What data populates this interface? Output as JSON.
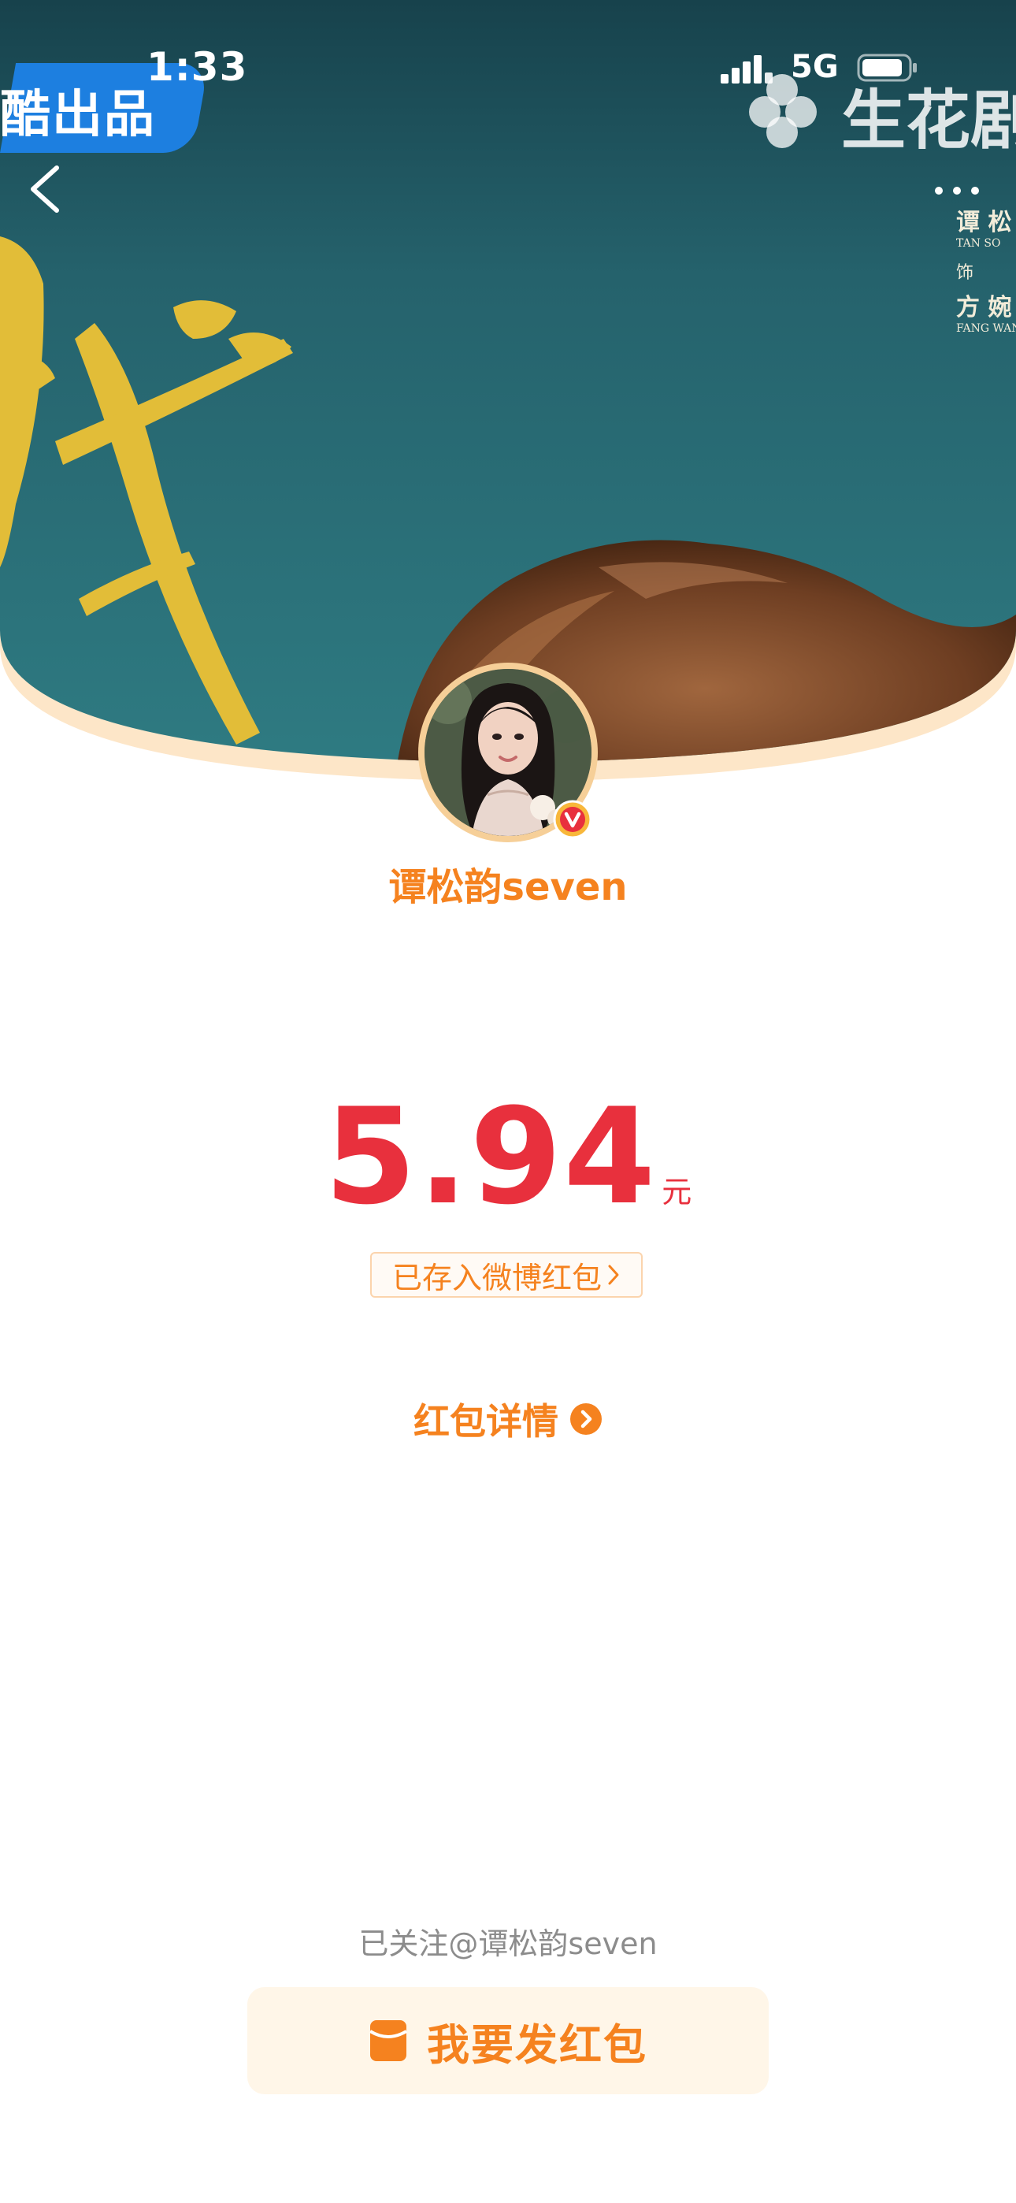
{
  "status_bar": {
    "time": "1:33",
    "network": "5G"
  },
  "header": {
    "brand_badge": "酷出品",
    "studio_logo": "生花剧",
    "cast_credit": {
      "actor_cn": "谭 松",
      "actor_en": "TAN SO",
      "role_prefix": "饰",
      "role_cn": "方 婉",
      "role_en": "FANG WAN"
    }
  },
  "profile": {
    "username": "谭松韵seven",
    "verified": true
  },
  "red_packet": {
    "amount": "5.94",
    "currency": "元",
    "saved_label": "已存入微博红包",
    "details_label": "红包详情"
  },
  "footer": {
    "follow_status": "已关注@谭松韵seven",
    "send_label": "我要发红包"
  },
  "colors": {
    "accent_orange": "#f5821f",
    "amount_red": "#e8303d",
    "banner_teal": "#2a6e78",
    "gold": "#e7c33c",
    "badge_blue": "#1d7fe0"
  },
  "icons": {
    "back": "chevron-left-icon",
    "more": "more-dots-icon",
    "verified": "verified-v-icon",
    "details": "arrow-right-circle-icon",
    "send": "red-packet-icon"
  }
}
